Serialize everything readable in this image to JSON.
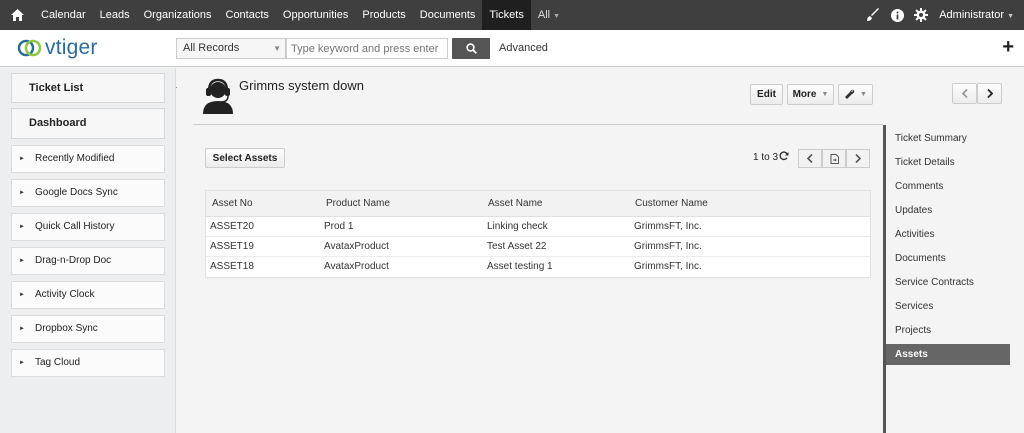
{
  "nav": {
    "items": [
      "Calendar",
      "Leads",
      "Organizations",
      "Contacts",
      "Opportunities",
      "Products",
      "Documents",
      "Tickets",
      "All"
    ],
    "active": "Tickets",
    "user": "Administrator"
  },
  "header": {
    "logo": "vtiger",
    "records_select": "All Records",
    "search_placeholder": "Type keyword and press enter",
    "advanced": "Advanced"
  },
  "sidebar": {
    "main_items": [
      "Ticket List",
      "Dashboard"
    ],
    "widgets": [
      "Recently Modified",
      "Google Docs Sync",
      "Quick Call History",
      "Drag-n-Drop Doc",
      "Activity Clock",
      "Dropbox Sync",
      "Tag Cloud"
    ]
  },
  "record": {
    "title": "Grimms system down",
    "edit": "Edit",
    "more": "More"
  },
  "assets": {
    "select_label": "Select Assets",
    "pager": "1 to 3",
    "columns": [
      "Asset No",
      "Product Name",
      "Asset Name",
      "Customer Name"
    ],
    "rows": [
      [
        "ASSET20",
        "Prod 1",
        "Linking check",
        "GrimmsFT, Inc."
      ],
      [
        "ASSET19",
        "AvataxProduct",
        "Test Asset 22",
        "GrimmsFT, Inc."
      ],
      [
        "ASSET18",
        "AvataxProduct",
        "Asset testing 1",
        "GrimmsFT, Inc."
      ]
    ]
  },
  "related": {
    "items": [
      "Ticket Summary",
      "Ticket Details",
      "Comments",
      "Updates",
      "Activities",
      "Documents",
      "Service Contracts",
      "Services",
      "Projects",
      "Assets"
    ],
    "active": "Assets"
  },
  "colors": {
    "nav_bg": "#3f3f3f",
    "nav_active": "#1f1f1f",
    "logo_blue": "#2c6c9c",
    "logo_green": "#8dc63f",
    "related_active": "#666666"
  }
}
